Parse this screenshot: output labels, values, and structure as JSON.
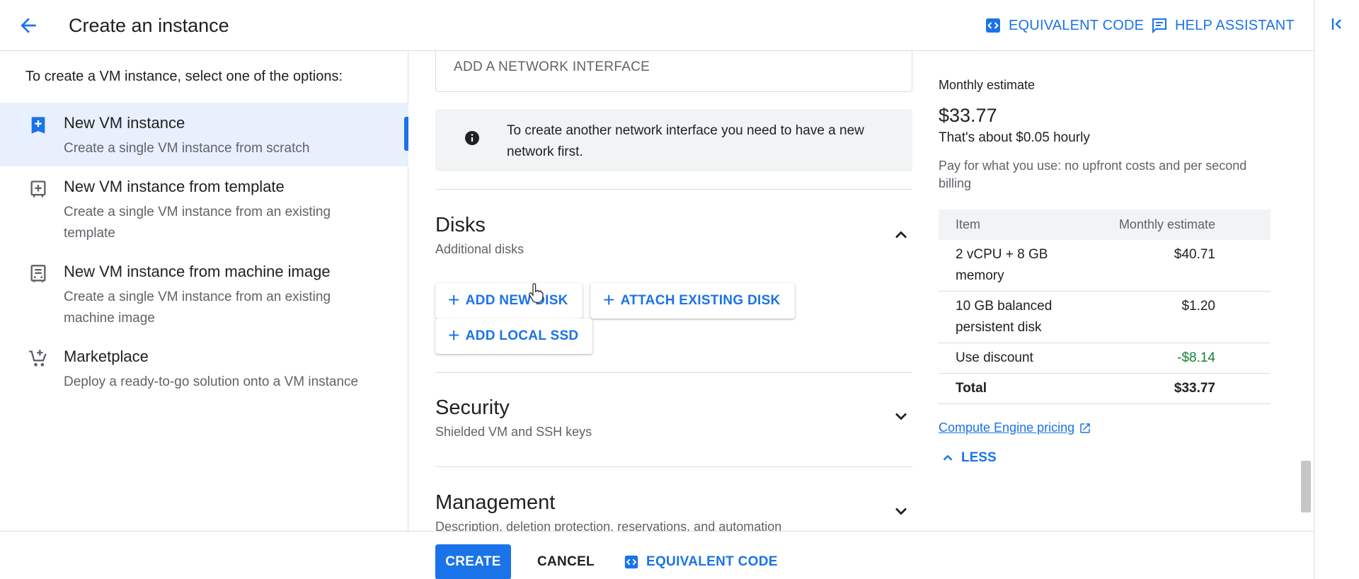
{
  "header": {
    "title": "Create an instance",
    "equivalent_code": "EQUIVALENT CODE",
    "help_assistant": "HELP ASSISTANT"
  },
  "left": {
    "intro": "To create a VM instance, select one of the options:",
    "options": [
      {
        "title": "New VM instance",
        "desc": "Create a single VM instance from scratch",
        "selected": true
      },
      {
        "title": "New VM instance from template",
        "desc": "Create a single VM instance from an existing template"
      },
      {
        "title": "New VM instance from machine image",
        "desc": "Create a single VM instance from an existing machine image"
      },
      {
        "title": "Marketplace",
        "desc": "Deploy a ready-to-go solution onto a VM instance"
      }
    ]
  },
  "main": {
    "add_network_interface": "ADD A NETWORK INTERFACE",
    "info": "To create another network interface you need to have a new network first.",
    "disks": {
      "title": "Disks",
      "subtitle": "Additional disks",
      "add_new_disk": "ADD NEW DISK",
      "attach_existing_disk": "ATTACH EXISTING DISK",
      "add_local_ssd": "ADD LOCAL SSD"
    },
    "security": {
      "title": "Security",
      "subtitle": "Shielded VM and SSH keys"
    },
    "management": {
      "title": "Management",
      "subtitle": "Description, deletion protection, reservations, and automation"
    }
  },
  "pricing": {
    "label": "Monthly estimate",
    "amount": "$33.77",
    "hourly": "That's about $0.05 hourly",
    "note": "Pay for what you use: no upfront costs and per second billing",
    "col_item": "Item",
    "col_estimate": "Monthly estimate",
    "rows": [
      {
        "item": "2 vCPU + 8 GB memory",
        "value": "$40.71"
      },
      {
        "item": "10 GB balanced persistent disk",
        "value": "$1.20"
      },
      {
        "item": "Use discount",
        "value": "-$8.14"
      },
      {
        "item": "Total",
        "value": "$33.77"
      }
    ],
    "link": "Compute Engine pricing",
    "less": "LESS"
  },
  "footer": {
    "create": "CREATE",
    "cancel": "CANCEL",
    "equivalent_code": "EQUIVALENT CODE"
  },
  "colors": {
    "accent": "#1a73e8",
    "selected_bg": "#e8f0fe",
    "discount": "#188038"
  }
}
